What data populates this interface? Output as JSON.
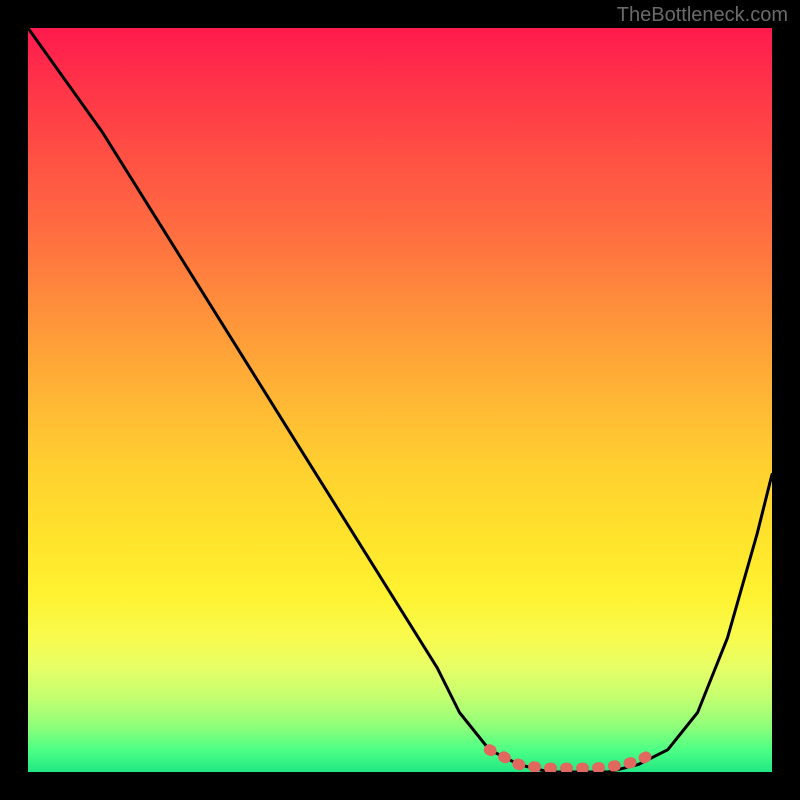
{
  "watermark": "TheBottleneck.com",
  "chart_data": {
    "type": "line",
    "title": "",
    "xlabel": "",
    "ylabel": "",
    "xlim": [
      0,
      100
    ],
    "ylim": [
      0,
      100
    ],
    "series": [
      {
        "name": "bottleneck-curve",
        "x": [
          0,
          5,
          10,
          15,
          20,
          25,
          30,
          35,
          40,
          45,
          50,
          55,
          58,
          62,
          66,
          70,
          74,
          78,
          82,
          86,
          90,
          94,
          98,
          100
        ],
        "y": [
          100,
          93,
          86,
          78,
          70,
          62,
          54,
          46,
          38,
          30,
          22,
          14,
          8,
          3,
          1,
          0,
          0,
          0,
          1,
          3,
          8,
          18,
          32,
          40
        ]
      }
    ],
    "optimal_band": {
      "name": "optimal-segment",
      "x": [
        62,
        64,
        66,
        68,
        70,
        72,
        74,
        76,
        78,
        80,
        82,
        84
      ],
      "y": [
        3,
        2,
        1,
        0.7,
        0.5,
        0.5,
        0.5,
        0.5,
        0.7,
        1,
        1.5,
        2.5
      ]
    },
    "gradient_stops": [
      {
        "pos": 0,
        "color": "#ff1a4d"
      },
      {
        "pos": 50,
        "color": "#ffbd34"
      },
      {
        "pos": 80,
        "color": "#fff230"
      },
      {
        "pos": 100,
        "color": "#21e884"
      }
    ]
  }
}
